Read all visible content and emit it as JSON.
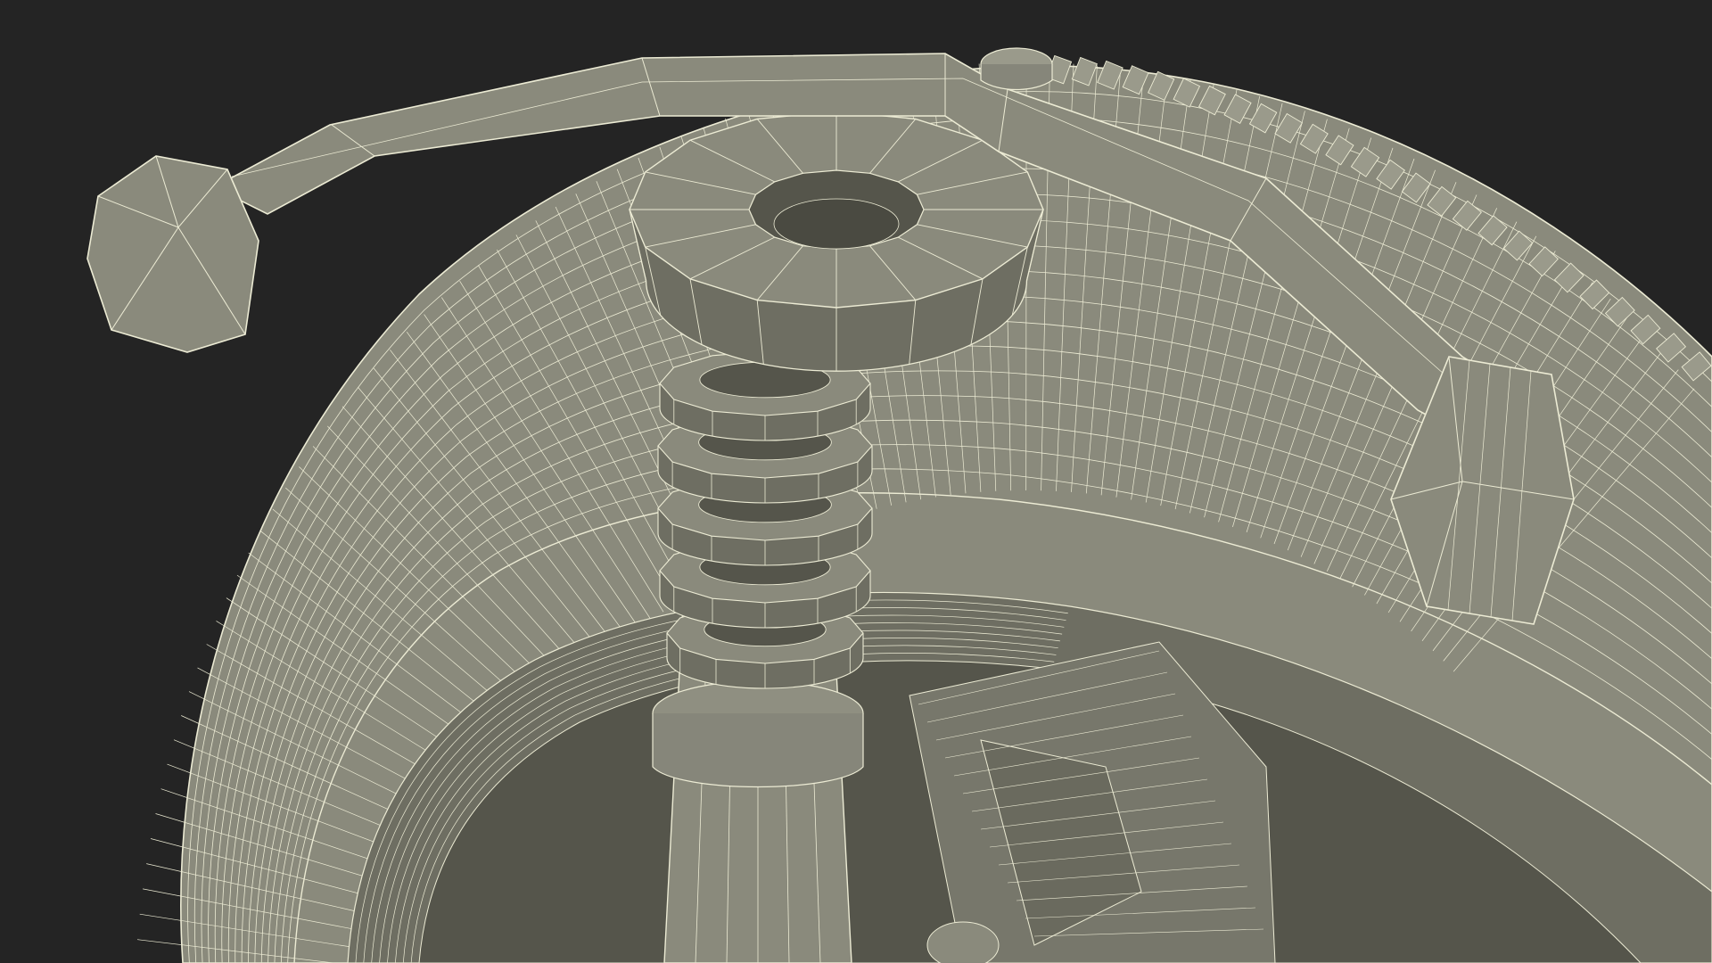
{
  "scene": {
    "subject": "wireframe-render-of-wheel-suspension-assembly",
    "colors": {
      "background": "#242424",
      "surface": "#8a8a7c",
      "surface_light": "#9a9a8b",
      "surface_dark": "#6e6e62",
      "shadow": "#55554b",
      "wire": "#ecebd4"
    },
    "parts": [
      "tire",
      "wheel-rim",
      "brake-disc",
      "coil-spring",
      "strut-body",
      "top-mount",
      "stabilizer-bar",
      "bolt"
    ]
  }
}
